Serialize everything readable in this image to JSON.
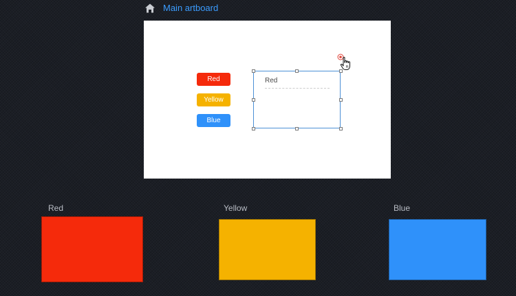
{
  "breadcrumb": {
    "icon": "home-icon",
    "title": "Main artboard",
    "link_color": "#3b9cff"
  },
  "artboard": {
    "buttons": [
      {
        "label": "Red",
        "color": "#f52a0b"
      },
      {
        "label": "Yellow",
        "color": "#f5b200"
      },
      {
        "label": "Blue",
        "color": "#2f91fa"
      }
    ],
    "selected_textbox": {
      "value": "Red"
    },
    "cursor": "hand-pointer-icon",
    "rotate_handle": "rotate-handle-icon"
  },
  "swatches": [
    {
      "label": "Red",
      "color": "#f52a0b"
    },
    {
      "label": "Yellow",
      "color": "#f5b200"
    },
    {
      "label": "Blue",
      "color": "#2f91fa"
    }
  ]
}
